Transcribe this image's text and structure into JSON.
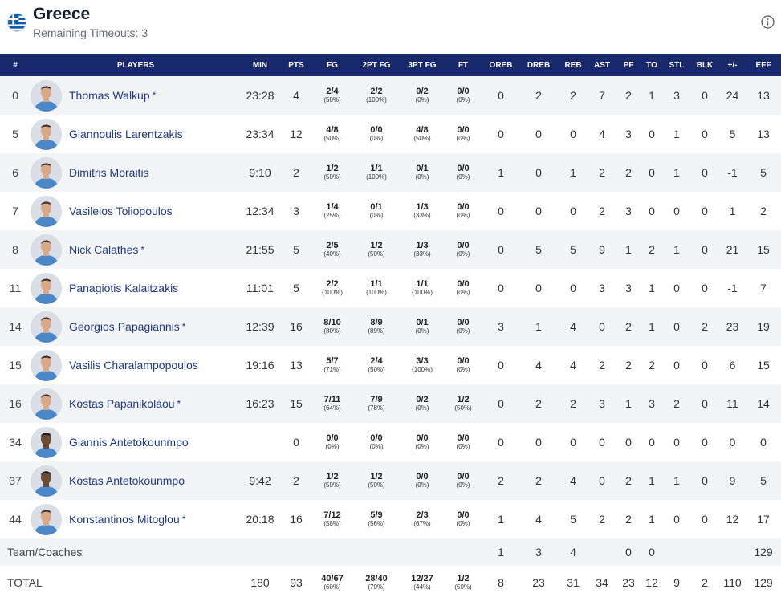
{
  "team": {
    "name": "Greece",
    "timeouts_label": "Remaining Timeouts: 3",
    "icon": "greece-flag-icon"
  },
  "header_icons": {
    "info": "info-icon"
  },
  "columns": [
    "#",
    "PLAYERS",
    "MIN",
    "PTS",
    "FG",
    "2PT FG",
    "3PT FG",
    "FT",
    "OREB",
    "DREB",
    "REB",
    "AST",
    "PF",
    "TO",
    "STL",
    "BLK",
    "+/-",
    "EFF"
  ],
  "players": [
    {
      "num": "0",
      "name": "Thomas Walkup",
      "starter": "*",
      "min": "23:28",
      "pts": "4",
      "fg": "2/4",
      "fg_pct": "(50%)",
      "fg2": "2/2",
      "fg2_pct": "(100%)",
      "fg3": "0/2",
      "fg3_pct": "(0%)",
      "ft": "0/0",
      "ft_pct": "(0%)",
      "oreb": "0",
      "dreb": "2",
      "reb": "2",
      "ast": "7",
      "pf": "2",
      "to": "1",
      "stl": "3",
      "blk": "0",
      "pm": "24",
      "eff": "13"
    },
    {
      "num": "5",
      "name": "Giannoulis Larentzakis",
      "starter": "",
      "min": "23:34",
      "pts": "12",
      "fg": "4/8",
      "fg_pct": "(50%)",
      "fg2": "0/0",
      "fg2_pct": "(0%)",
      "fg3": "4/8",
      "fg3_pct": "(50%)",
      "ft": "0/0",
      "ft_pct": "(0%)",
      "oreb": "0",
      "dreb": "0",
      "reb": "0",
      "ast": "4",
      "pf": "3",
      "to": "0",
      "stl": "1",
      "blk": "0",
      "pm": "5",
      "eff": "13"
    },
    {
      "num": "6",
      "name": "Dimitris Moraitis",
      "starter": "",
      "min": "9:10",
      "pts": "2",
      "fg": "1/2",
      "fg_pct": "(50%)",
      "fg2": "1/1",
      "fg2_pct": "(100%)",
      "fg3": "0/1",
      "fg3_pct": "(0%)",
      "ft": "0/0",
      "ft_pct": "(0%)",
      "oreb": "1",
      "dreb": "0",
      "reb": "1",
      "ast": "2",
      "pf": "2",
      "to": "0",
      "stl": "1",
      "blk": "0",
      "pm": "-1",
      "eff": "5"
    },
    {
      "num": "7",
      "name": "Vasileios Toliopoulos",
      "starter": "",
      "min": "12:34",
      "pts": "3",
      "fg": "1/4",
      "fg_pct": "(25%)",
      "fg2": "0/1",
      "fg2_pct": "(0%)",
      "fg3": "1/3",
      "fg3_pct": "(33%)",
      "ft": "0/0",
      "ft_pct": "(0%)",
      "oreb": "0",
      "dreb": "0",
      "reb": "0",
      "ast": "2",
      "pf": "3",
      "to": "0",
      "stl": "0",
      "blk": "0",
      "pm": "1",
      "eff": "2"
    },
    {
      "num": "8",
      "name": "Nick Calathes",
      "starter": "*",
      "min": "21:55",
      "pts": "5",
      "fg": "2/5",
      "fg_pct": "(40%)",
      "fg2": "1/2",
      "fg2_pct": "(50%)",
      "fg3": "1/3",
      "fg3_pct": "(33%)",
      "ft": "0/0",
      "ft_pct": "(0%)",
      "oreb": "0",
      "dreb": "5",
      "reb": "5",
      "ast": "9",
      "pf": "1",
      "to": "2",
      "stl": "1",
      "blk": "0",
      "pm": "21",
      "eff": "15"
    },
    {
      "num": "11",
      "name": "Panagiotis Kalaitzakis",
      "starter": "",
      "min": "11:01",
      "pts": "5",
      "fg": "2/2",
      "fg_pct": "(100%)",
      "fg2": "1/1",
      "fg2_pct": "(100%)",
      "fg3": "1/1",
      "fg3_pct": "(100%)",
      "ft": "0/0",
      "ft_pct": "(0%)",
      "oreb": "0",
      "dreb": "0",
      "reb": "0",
      "ast": "3",
      "pf": "3",
      "to": "1",
      "stl": "0",
      "blk": "0",
      "pm": "-1",
      "eff": "7"
    },
    {
      "num": "14",
      "name": "Georgios Papagiannis",
      "starter": "*",
      "min": "12:39",
      "pts": "16",
      "fg": "8/10",
      "fg_pct": "(80%)",
      "fg2": "8/9",
      "fg2_pct": "(89%)",
      "fg3": "0/1",
      "fg3_pct": "(0%)",
      "ft": "0/0",
      "ft_pct": "(0%)",
      "oreb": "3",
      "dreb": "1",
      "reb": "4",
      "ast": "0",
      "pf": "2",
      "to": "1",
      "stl": "0",
      "blk": "2",
      "pm": "23",
      "eff": "19"
    },
    {
      "num": "15",
      "name": "Vasilis Charalampopoulos",
      "starter": "",
      "min": "19:16",
      "pts": "13",
      "fg": "5/7",
      "fg_pct": "(71%)",
      "fg2": "2/4",
      "fg2_pct": "(50%)",
      "fg3": "3/3",
      "fg3_pct": "(100%)",
      "ft": "0/0",
      "ft_pct": "(0%)",
      "oreb": "0",
      "dreb": "4",
      "reb": "4",
      "ast": "2",
      "pf": "2",
      "to": "2",
      "stl": "0",
      "blk": "0",
      "pm": "6",
      "eff": "15"
    },
    {
      "num": "16",
      "name": "Kostas Papanikolaou",
      "starter": "*",
      "min": "16:23",
      "pts": "15",
      "fg": "7/11",
      "fg_pct": "(64%)",
      "fg2": "7/9",
      "fg2_pct": "(78%)",
      "fg3": "0/2",
      "fg3_pct": "(0%)",
      "ft": "1/2",
      "ft_pct": "(50%)",
      "oreb": "0",
      "dreb": "2",
      "reb": "2",
      "ast": "3",
      "pf": "1",
      "to": "3",
      "stl": "2",
      "blk": "0",
      "pm": "11",
      "eff": "14"
    },
    {
      "num": "34",
      "name": "Giannis Antetokounmpo",
      "starter": "",
      "min": "",
      "pts": "0",
      "fg": "0/0",
      "fg_pct": "(0%)",
      "fg2": "0/0",
      "fg2_pct": "(0%)",
      "fg3": "0/0",
      "fg3_pct": "(0%)",
      "ft": "0/0",
      "ft_pct": "(0%)",
      "oreb": "0",
      "dreb": "0",
      "reb": "0",
      "ast": "0",
      "pf": "0",
      "to": "0",
      "stl": "0",
      "blk": "0",
      "pm": "0",
      "eff": "0"
    },
    {
      "num": "37",
      "name": "Kostas Antetokounmpo",
      "starter": "",
      "min": "9:42",
      "pts": "2",
      "fg": "1/2",
      "fg_pct": "(50%)",
      "fg2": "1/2",
      "fg2_pct": "(50%)",
      "fg3": "0/0",
      "fg3_pct": "(0%)",
      "ft": "0/0",
      "ft_pct": "(0%)",
      "oreb": "2",
      "dreb": "2",
      "reb": "4",
      "ast": "0",
      "pf": "2",
      "to": "1",
      "stl": "1",
      "blk": "0",
      "pm": "9",
      "eff": "5"
    },
    {
      "num": "44",
      "name": "Konstantinos Mitoglou",
      "starter": "*",
      "min": "20:18",
      "pts": "16",
      "fg": "7/12",
      "fg_pct": "(58%)",
      "fg2": "5/9",
      "fg2_pct": "(56%)",
      "fg3": "2/3",
      "fg3_pct": "(67%)",
      "ft": "0/0",
      "ft_pct": "(0%)",
      "oreb": "1",
      "dreb": "4",
      "reb": "5",
      "ast": "2",
      "pf": "2",
      "to": "1",
      "stl": "0",
      "blk": "0",
      "pm": "12",
      "eff": "17"
    }
  ],
  "team_row": {
    "label": "Team/Coaches",
    "oreb": "1",
    "dreb": "3",
    "reb": "4",
    "ast": "",
    "pf": "0",
    "to": "0",
    "stl": "",
    "blk": "",
    "pm": "",
    "eff": "129"
  },
  "total_row": {
    "label": "TOTAL",
    "min": "180",
    "pts": "93",
    "fg": "40/67",
    "fg_pct": "(60%)",
    "fg2": "28/40",
    "fg2_pct": "(70%)",
    "fg3": "12/27",
    "fg3_pct": "(44%)",
    "ft": "1/2",
    "ft_pct": "(50%)",
    "oreb": "8",
    "dreb": "23",
    "reb": "31",
    "ast": "34",
    "pf": "23",
    "to": "12",
    "stl": "9",
    "blk": "2",
    "pm": "110",
    "eff": "129"
  },
  "colors": {
    "header_bg": "#17296b",
    "player_link": "#1d3a8a",
    "alt_row": "#f3f4f6"
  }
}
